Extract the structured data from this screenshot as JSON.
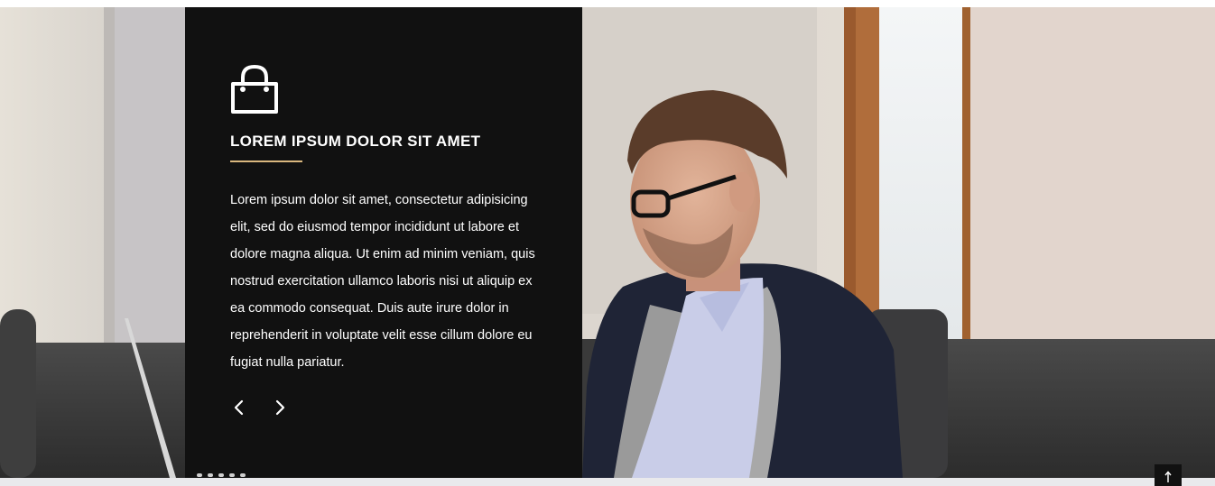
{
  "hero": {
    "title": "LOREM IPSUM DOLOR SIT AMET",
    "body": "Lorem ipsum dolor sit amet, consectetur adipisicing elit, sed do eiusmod tempor incididunt ut labore et dolore magna aliqua. Ut enim ad minim veniam, quis nostrud exercitation ullamco laboris nisi ut aliquip ex ea commodo consequat. Duis aute irure dolor in reprehenderit in voluptate velit esse cillum dolore eu fugiat nulla pariatur.",
    "icon": "shopping-bag-icon",
    "prev_icon": "chevron-left-icon",
    "next_icon": "chevron-right-icon"
  },
  "back_to_top": {
    "icon": "arrow-up-icon"
  },
  "colors": {
    "panel_bg": "#111111",
    "accent": "#d9b77e",
    "text": "#ffffff",
    "footer_strip": "#e9e9ec"
  }
}
